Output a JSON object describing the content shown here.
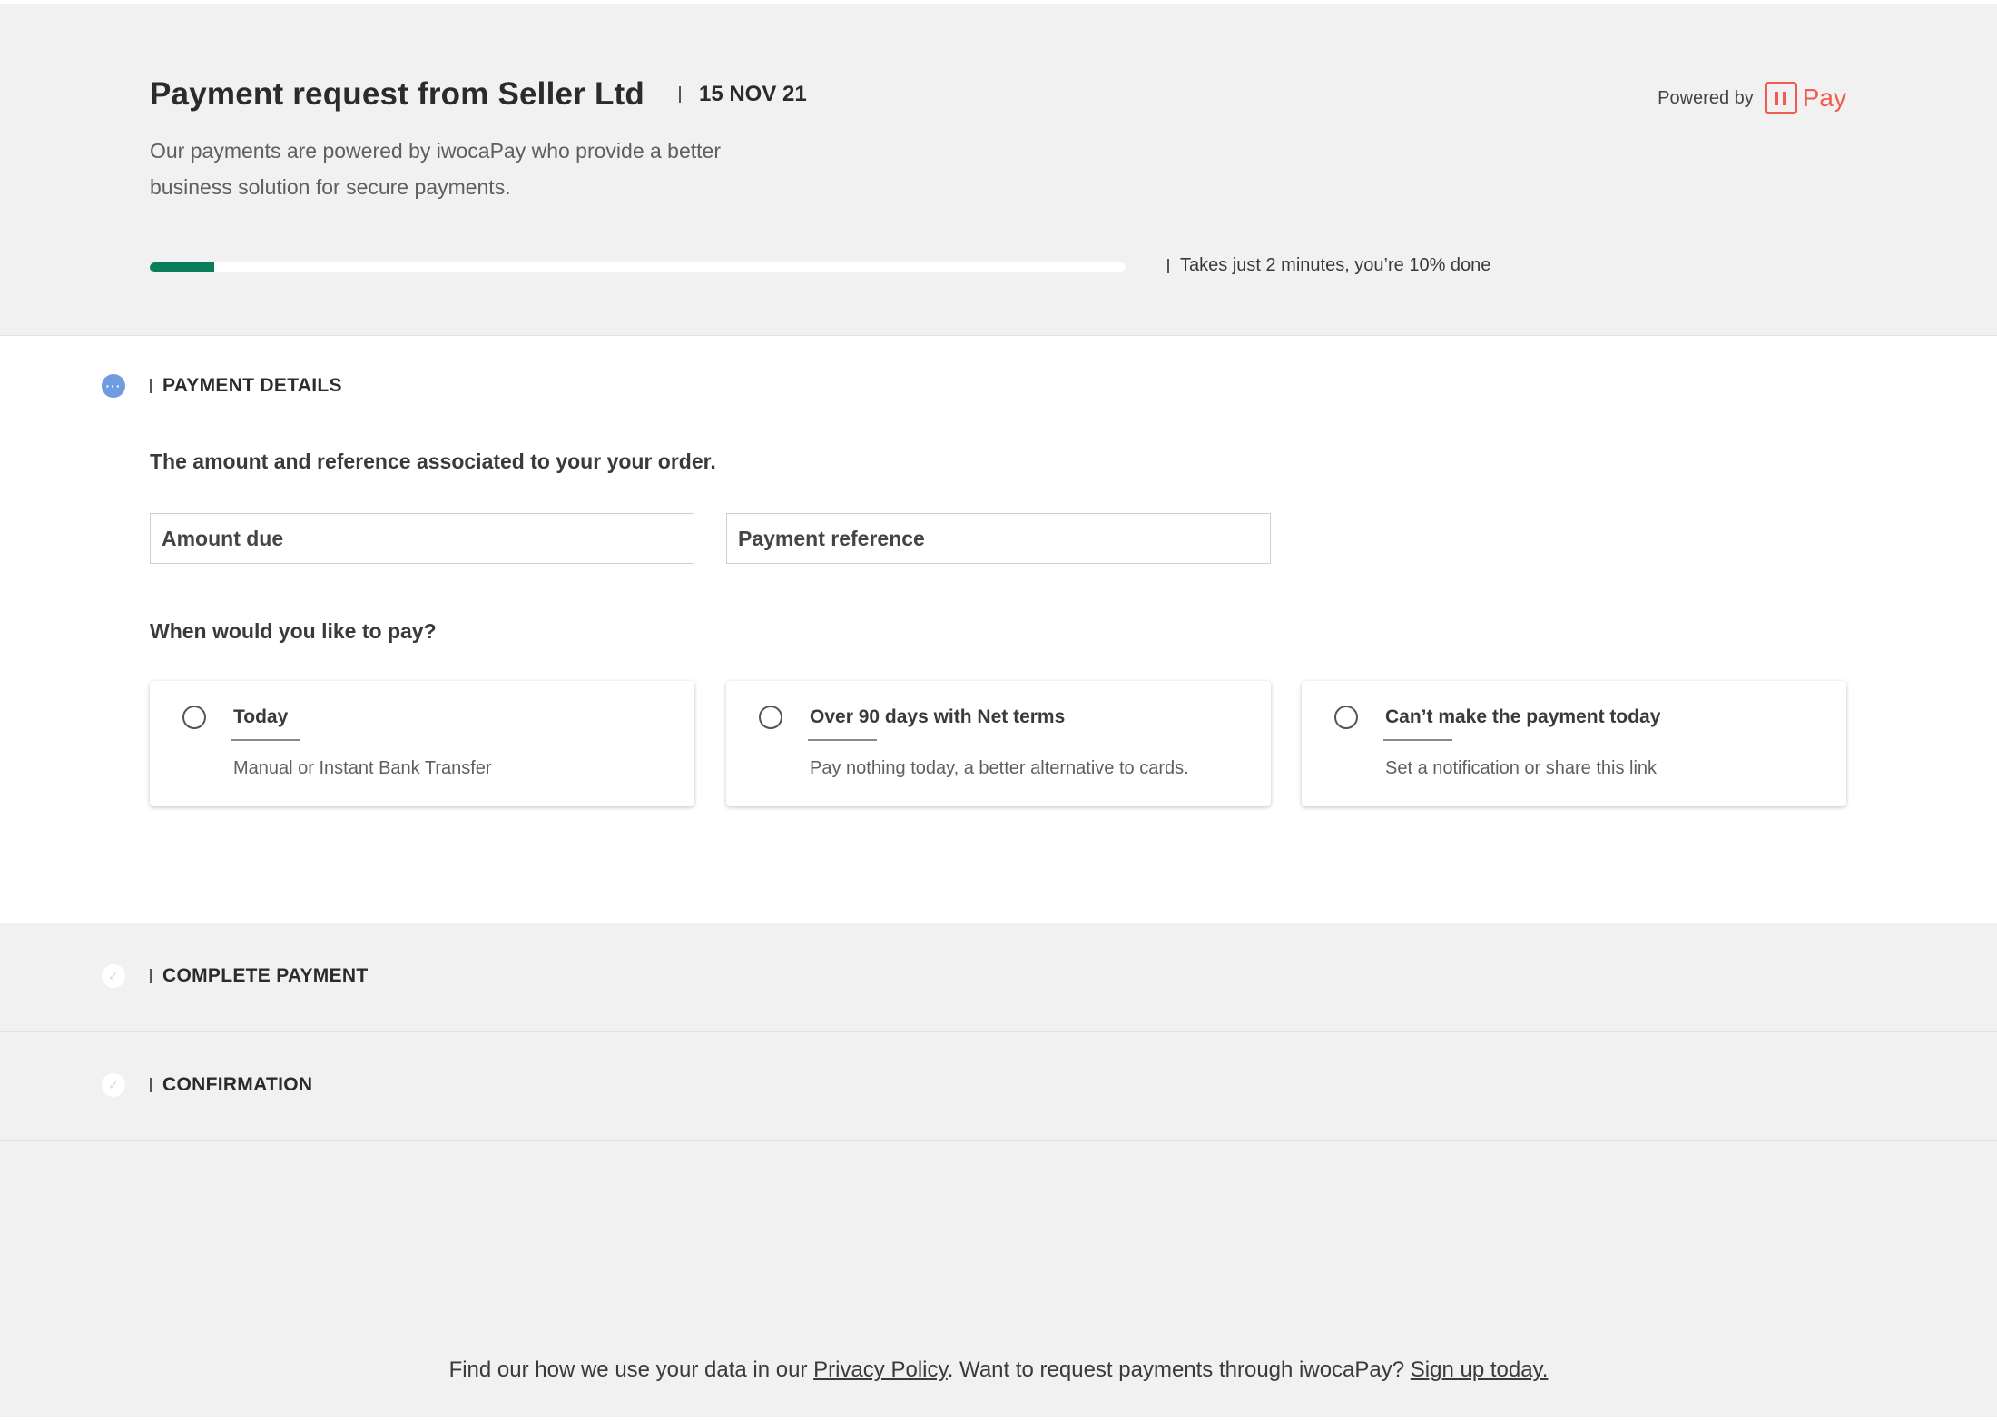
{
  "header": {
    "title": "Payment request from Seller Ltd",
    "date": "15 NOV 21",
    "subtitle": "Our payments are powered by iwocaPay who provide a better business solution for secure payments.",
    "powered_by": "Powered by",
    "brand_text": "Pay",
    "brand_color": "#ef5b50",
    "progress_percent": 10,
    "progress_color": "#0a7d5a",
    "progress_note": "Takes just 2 minutes, you’re 10% done"
  },
  "steps": {
    "payment_details": {
      "label": "PAYMENT DETAILS",
      "icon": "more-dots-icon",
      "description": "The amount and reference associated to your your order.",
      "amount_placeholder": "Amount due",
      "reference_placeholder": "Payment reference",
      "question": "When would you like to pay?",
      "options": [
        {
          "title": "Today",
          "subtitle": "Manual or Instant Bank Transfer"
        },
        {
          "title": "Over 90 days with Net terms",
          "subtitle": "Pay nothing today, a better alternative to cards."
        },
        {
          "title": "Can’t make the payment today",
          "subtitle": "Set a notification or share this link"
        }
      ]
    },
    "complete_payment": {
      "label": "COMPLETE PAYMENT",
      "icon": "check-icon"
    },
    "confirmation": {
      "label": "CONFIRMATION",
      "icon": "check-icon"
    }
  },
  "footer": {
    "text1": "Find our how we use your data in our ",
    "privacy_link": "Privacy Policy",
    "text2": ".  Want to request payments through iwocaPay? ",
    "signup_link": "Sign up today."
  }
}
